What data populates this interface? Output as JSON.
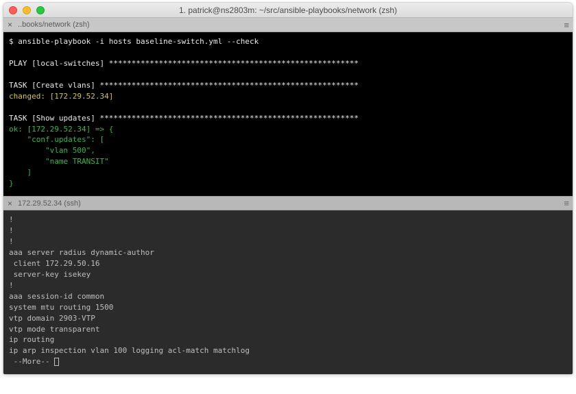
{
  "window": {
    "title": "1. patrick@ns2803m: ~/src/ansible-playbooks/network (zsh)"
  },
  "panes": [
    {
      "tab": {
        "close": "×",
        "label": "..books/network (zsh)",
        "menu": "≡"
      },
      "lines": [
        {
          "segments": [
            {
              "cls": "c-white",
              "text": "$ ansible-playbook -i hosts baseline-switch.yml --check"
            }
          ]
        },
        {
          "segments": [
            {
              "cls": "",
              "text": " "
            }
          ]
        },
        {
          "segments": [
            {
              "cls": "c-white",
              "text": "PLAY [local-switches] *******************************************************"
            }
          ]
        },
        {
          "segments": [
            {
              "cls": "",
              "text": " "
            }
          ]
        },
        {
          "segments": [
            {
              "cls": "c-white",
              "text": "TASK [Create vlans] *********************************************************"
            }
          ]
        },
        {
          "segments": [
            {
              "cls": "c-yellow",
              "text": "changed: [172.29.52.34]"
            }
          ]
        },
        {
          "segments": [
            {
              "cls": "",
              "text": " "
            }
          ]
        },
        {
          "segments": [
            {
              "cls": "c-white",
              "text": "TASK [Show updates] *********************************************************"
            }
          ]
        },
        {
          "segments": [
            {
              "cls": "c-green",
              "text": "ok: [172.29.52.34] => {"
            }
          ]
        },
        {
          "segments": [
            {
              "cls": "c-green",
              "text": "    \"conf.updates\": ["
            }
          ]
        },
        {
          "segments": [
            {
              "cls": "c-green",
              "text": "        \"vlan 500\","
            }
          ]
        },
        {
          "segments": [
            {
              "cls": "c-green",
              "text": "        \"name TRANSIT\""
            }
          ]
        },
        {
          "segments": [
            {
              "cls": "c-green",
              "text": "    ]"
            }
          ]
        },
        {
          "segments": [
            {
              "cls": "c-green",
              "text": "}"
            }
          ]
        }
      ]
    },
    {
      "tab": {
        "close": "×",
        "label": "172.29.52.34 (ssh)",
        "menu": "≡"
      },
      "lines": [
        {
          "segments": [
            {
              "cls": "",
              "text": "!"
            }
          ]
        },
        {
          "segments": [
            {
              "cls": "",
              "text": "!"
            }
          ]
        },
        {
          "segments": [
            {
              "cls": "",
              "text": "!"
            }
          ]
        },
        {
          "segments": [
            {
              "cls": "",
              "text": "aaa server radius dynamic-author"
            }
          ]
        },
        {
          "segments": [
            {
              "cls": "",
              "text": " client 172.29.50.16"
            }
          ]
        },
        {
          "segments": [
            {
              "cls": "",
              "text": " server-key isekey"
            }
          ]
        },
        {
          "segments": [
            {
              "cls": "",
              "text": "!"
            }
          ]
        },
        {
          "segments": [
            {
              "cls": "",
              "text": "aaa session-id common"
            }
          ]
        },
        {
          "segments": [
            {
              "cls": "",
              "text": "system mtu routing 1500"
            }
          ]
        },
        {
          "segments": [
            {
              "cls": "",
              "text": "vtp domain 2903-VTP"
            }
          ]
        },
        {
          "segments": [
            {
              "cls": "",
              "text": "vtp mode transparent"
            }
          ]
        },
        {
          "segments": [
            {
              "cls": "",
              "text": "ip routing"
            }
          ]
        },
        {
          "segments": [
            {
              "cls": "",
              "text": "ip arp inspection vlan 100 logging acl-match matchlog"
            }
          ]
        },
        {
          "segments": [
            {
              "cls": "",
              "text": " --More-- "
            }
          ],
          "cursor": true
        }
      ]
    }
  ]
}
